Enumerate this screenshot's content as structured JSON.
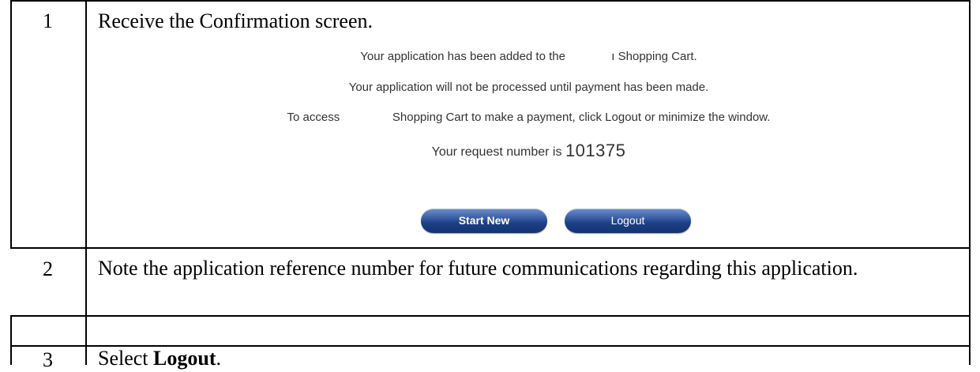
{
  "steps": [
    {
      "number": "1",
      "text": "Receive the Confirmation screen."
    },
    {
      "number": "2",
      "text": "Note the application reference number for future communications regarding this application."
    },
    {
      "number": "3",
      "text_prefix": "Select ",
      "text_bold": "Logout",
      "text_suffix": "."
    }
  ],
  "confirmation_screen": {
    "line1": "Your application has been added to the              ı Shopping Cart.",
    "line2": "Your application will not be processed until payment has been made.",
    "line3": "To access                Shopping Cart to make a payment, click Logout or minimize the window.",
    "request_label": "Your request number is",
    "request_number": "101375",
    "start_new_label": "Start New",
    "logout_label": "Logout"
  }
}
